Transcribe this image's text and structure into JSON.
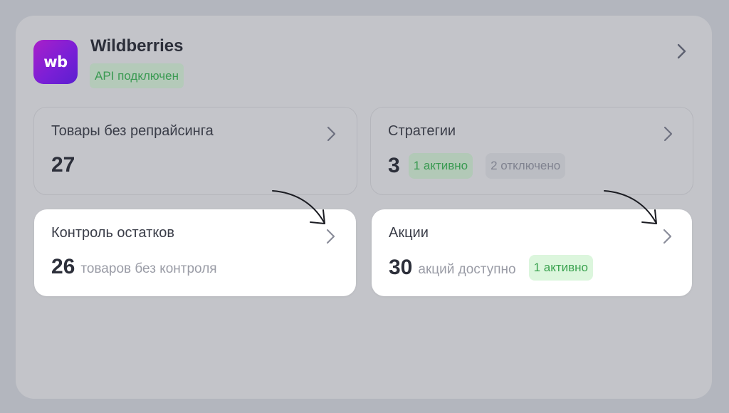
{
  "shop": {
    "logo_text": "wb",
    "name": "Wildberries",
    "status_badge": "API подключен"
  },
  "cards": {
    "no_repricing": {
      "title": "Товары без репрайсинга",
      "count": "27"
    },
    "strategies": {
      "title": "Стратегии",
      "count": "3",
      "active_badge": "1 активно",
      "disabled_badge": "2 отключено"
    },
    "stock_control": {
      "title": "Контроль остатков",
      "count": "26",
      "caption": "товаров без контроля"
    },
    "promotions": {
      "title": "Акции",
      "count": "30",
      "caption": "акций доступно",
      "active_badge": "1 активно"
    }
  },
  "icons": {
    "chevron": "chevron-right-icon",
    "arrow": "hand-drawn-arrow-icon"
  },
  "colors": {
    "brand_gradient_start": "#a91fc9",
    "brand_gradient_end": "#5b1fd0",
    "success_green": "#3a9a52",
    "card_bright": "#ffffff",
    "overlay_panel": "#c3c4c9"
  }
}
